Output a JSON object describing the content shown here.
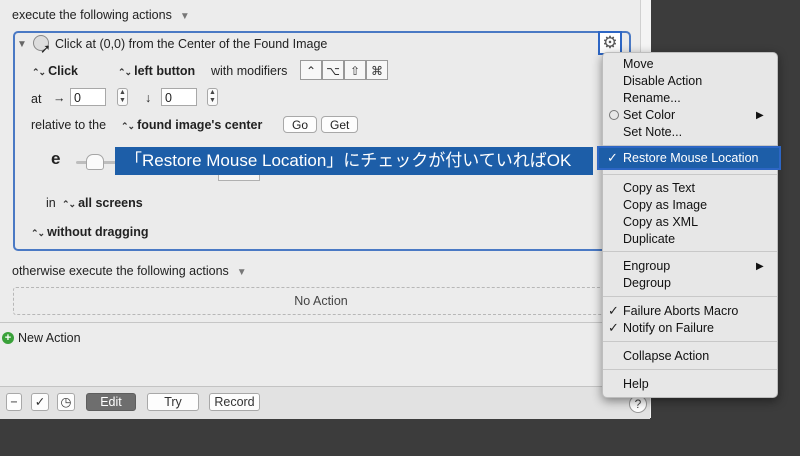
{
  "section1": {
    "title": "execute the following actions"
  },
  "action": {
    "title": "Click at (0,0) from the Center of the Found Image",
    "click_type": "Click",
    "button": "left button",
    "modifiers_label": "with modifiers",
    "modifier_symbols": [
      "⌃",
      "⌥",
      "⇧",
      "⌘"
    ],
    "at_label": "at",
    "x_arrow": "→",
    "x_value": "0",
    "y_arrow": "↓",
    "y_value": "0",
    "relative_label": "relative to the",
    "relative_value": "found image's center",
    "go_label": "Go",
    "get_label": "Get",
    "partial_letter": "e",
    "in_label": "in",
    "screens_value": "all screens",
    "drag_value": "without dragging"
  },
  "callout": {
    "text": "「Restore Mouse Location」にチェックが付いていればOK"
  },
  "section2": {
    "title": "otherwise execute the following actions",
    "placeholder": "No Action"
  },
  "new_action": {
    "label": "New Action"
  },
  "toolbar": {
    "edit": "Edit",
    "try": "Try",
    "record": "Record",
    "help": "?"
  },
  "menu": {
    "items": [
      {
        "label": "Move"
      },
      {
        "label": "Disable Action"
      },
      {
        "label": "Rename..."
      },
      {
        "label": "Set Color"
      },
      {
        "label": "Set Note..."
      },
      {
        "label": "Restore Mouse Location",
        "checked": true,
        "highlighted": true
      },
      {
        "label": "Copy as Text"
      },
      {
        "label": "Copy as Image"
      },
      {
        "label": "Copy as XML"
      },
      {
        "label": "Duplicate"
      },
      {
        "label": "Engroup"
      },
      {
        "label": "Degroup"
      },
      {
        "label": "Failure Aborts Macro",
        "checked": true
      },
      {
        "label": "Notify on Failure",
        "checked": true
      },
      {
        "label": "Collapse Action"
      },
      {
        "label": "Help"
      }
    ],
    "check_glyph": "✓",
    "submenu_glyph": "▶"
  },
  "colors": {
    "accent": "#2d66c4",
    "callout_bg": "#1d5ea8",
    "add_green": "#3aa13a"
  }
}
